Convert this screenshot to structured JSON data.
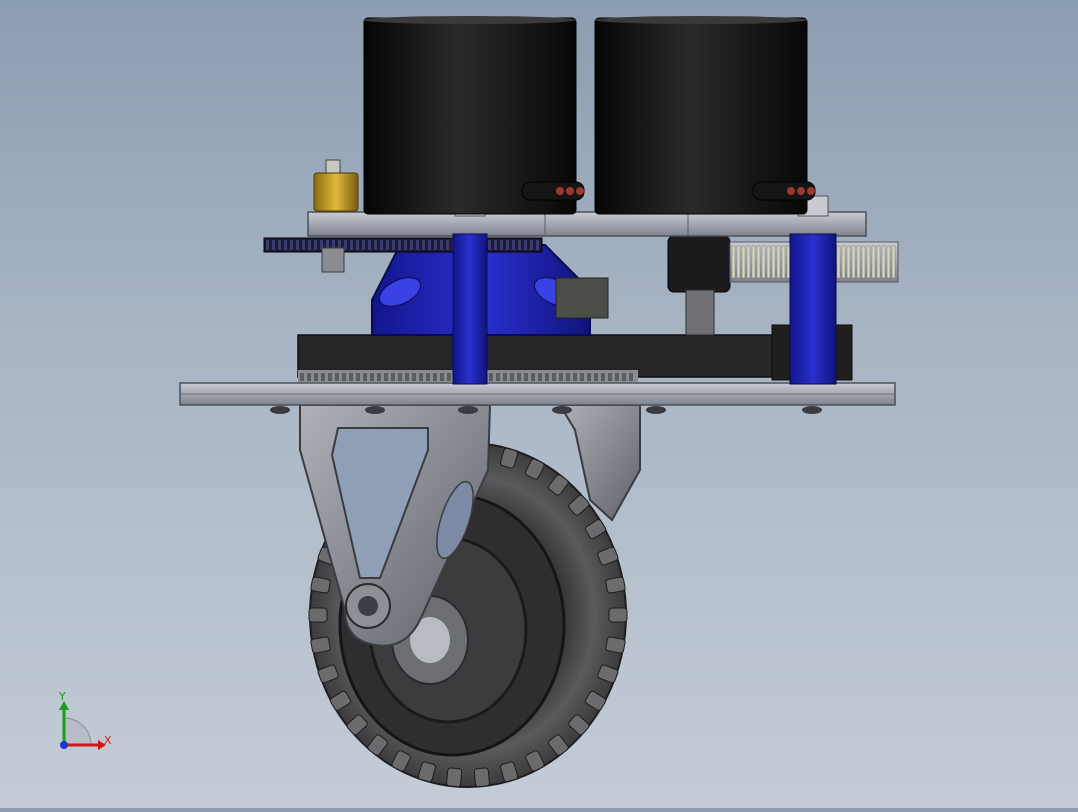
{
  "viewport": {
    "background_top": "#8c9db2",
    "background_bottom": "#c4ccd6"
  },
  "model": {
    "motor_color": "#0d0d0d",
    "bracket_color": "#1c20a8",
    "plate_color": "#9aa0aa",
    "belt_color": "#2a2a2a",
    "gear_color": "#d8d6c2",
    "tire_color": "#4a4a4c",
    "fork_color": "#8a8d96",
    "coupler_color": "#c9a227",
    "icons": [
      "motor-left",
      "motor-right",
      "top-plate",
      "standoff",
      "timing-belt",
      "spur-gear",
      "caster-fork",
      "wheel",
      "axle-bolt"
    ]
  },
  "triad": {
    "x_label": "X",
    "y_label": "Y",
    "x_color": "#d01818",
    "y_color": "#18a018",
    "z_color": "#1838d0"
  }
}
